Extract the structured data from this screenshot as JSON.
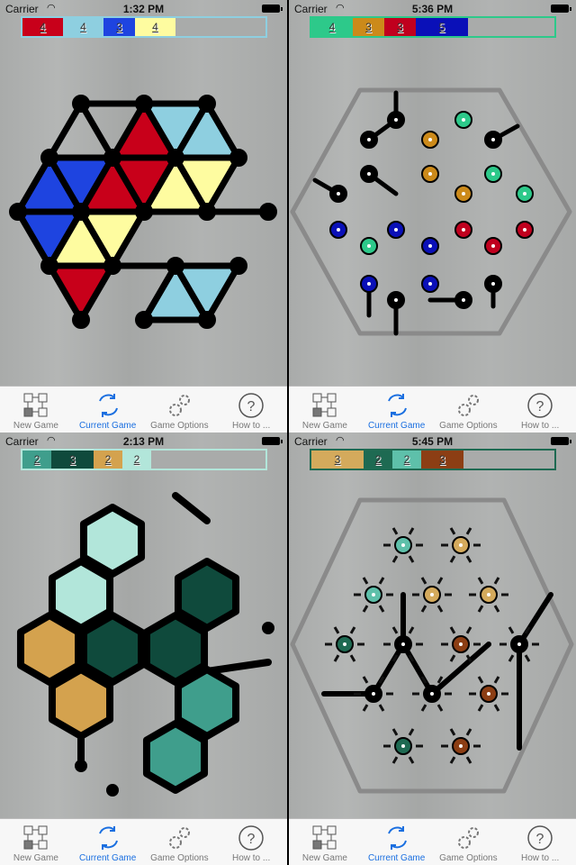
{
  "tabs": [
    "New Game",
    "Current Game",
    "Game Options",
    "How to ..."
  ],
  "active_tab": 1,
  "icons": [
    "new-game-grid-icon",
    "refresh-cycle-icon",
    "gears-icon",
    "question-mark-icon"
  ],
  "panels": [
    {
      "status": {
        "carrier": "Carrier",
        "time": "1:32 PM"
      },
      "score_border": "#8ecfe0",
      "scores": [
        {
          "value": "4",
          "color": "#c8001a"
        },
        {
          "value": "4",
          "color": "#8ecfe0"
        },
        {
          "value": "3",
          "color": "#1e44e0"
        },
        {
          "value": "4",
          "color": "#fefca0"
        }
      ],
      "board_type": "triangles"
    },
    {
      "status": {
        "carrier": "Carrier",
        "time": "5:36 PM"
      },
      "score_border": "#2dc98a",
      "scores": [
        {
          "value": "4",
          "color": "#2dc98a"
        },
        {
          "value": "3",
          "color": "#cc8a1a"
        },
        {
          "value": "3",
          "color": "#c0001e"
        },
        {
          "value": "5",
          "color": "#0a10b8"
        }
      ],
      "board_type": "hex-nodes"
    },
    {
      "status": {
        "carrier": "Carrier",
        "time": "2:13 PM"
      },
      "score_border": "#b2e6da",
      "scores": [
        {
          "value": "2",
          "color": "#3f9e8c"
        },
        {
          "value": "3",
          "color": "#0f4a3c"
        },
        {
          "value": "2",
          "color": "#d4a24e"
        },
        {
          "value": "2",
          "color": "#b2e6da"
        }
      ],
      "board_type": "hexagons"
    },
    {
      "status": {
        "carrier": "Carrier",
        "time": "5:45 PM"
      },
      "score_border": "#1e6a52",
      "scores": [
        {
          "value": "3",
          "color": "#d4aa5c"
        },
        {
          "value": "2",
          "color": "#1e6a52"
        },
        {
          "value": "2",
          "color": "#5ec0aa"
        },
        {
          "value": "3",
          "color": "#8c3e14"
        }
      ],
      "board_type": "star-nodes"
    }
  ]
}
